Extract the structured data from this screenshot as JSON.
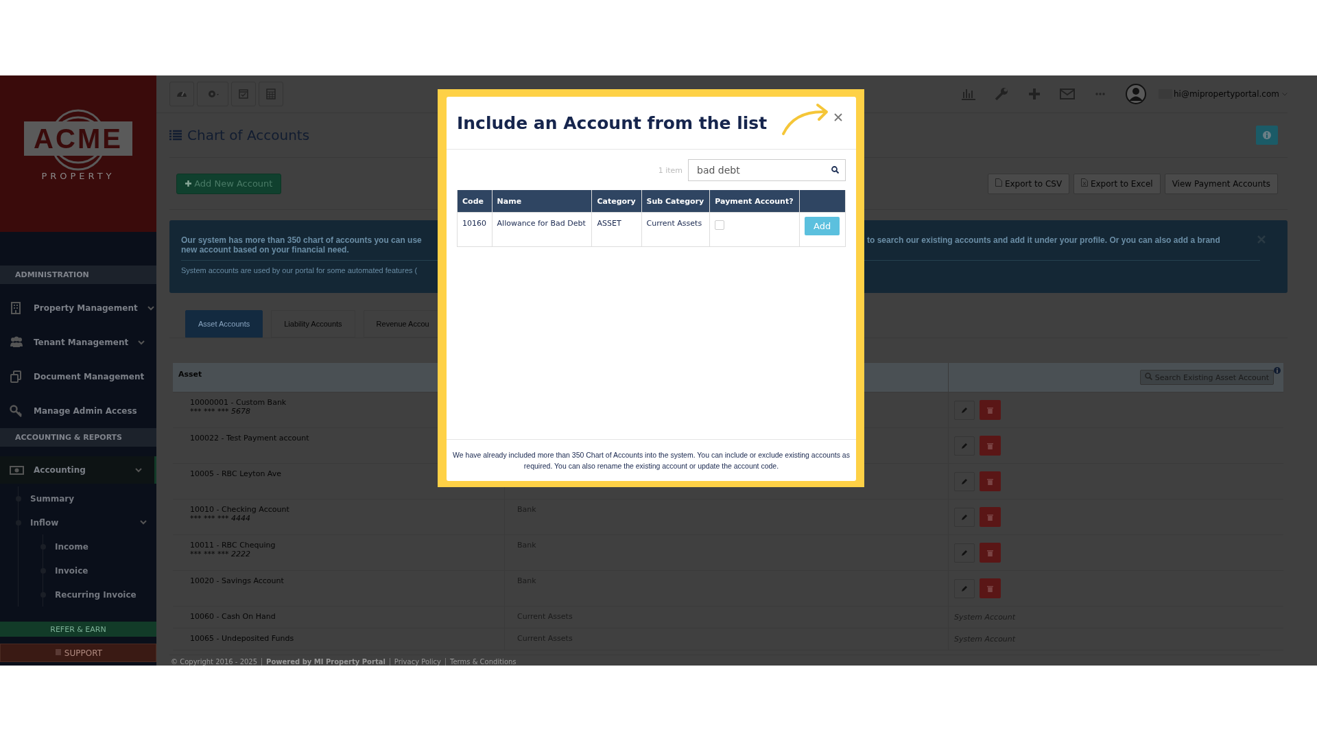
{
  "sidebar": {
    "logo": {
      "word": "ACME",
      "tagline": "PROPERTY"
    },
    "sections": [
      {
        "title": "ADMINISTRATION",
        "items": [
          {
            "label": "Property Management",
            "kind": "group",
            "selected": false
          },
          {
            "label": "Tenant Management",
            "kind": "group",
            "selected": false
          },
          {
            "label": "Document Management",
            "kind": "link",
            "selected": false
          },
          {
            "label": "Manage Admin Access",
            "kind": "link",
            "selected": false
          }
        ]
      },
      {
        "title": "ACCOUNTING & REPORTS",
        "items": [
          {
            "label": "Accounting",
            "kind": "group",
            "expanded": true,
            "selected": true,
            "children": [
              {
                "label": "Summary"
              },
              {
                "label": "Inflow",
                "kind": "group",
                "expanded": true,
                "children": [
                  {
                    "label": "Income"
                  },
                  {
                    "label": "Invoice"
                  },
                  {
                    "label": "Recurring Invoice"
                  }
                ]
              }
            ]
          }
        ]
      }
    ],
    "refer_button": "REFER & EARN",
    "support_button": "SUPPORT"
  },
  "topbar": {
    "user_email": "hi@mipropertyportal.com"
  },
  "page": {
    "title": "Chart of Accounts",
    "add_button": "Add New Account",
    "export_buttons": [
      "Export to CSV",
      "Export to Excel"
    ],
    "view_button": "View Payment Accounts",
    "banner": {
      "line_left": "Our system has more than 350 chart of accounts you can use",
      "line_right": "to search our existing accounts and add it under your profile. Or you can also add a brand",
      "line_2": "new account based on your financial need.",
      "note": "System accounts are used by our portal for some automated features ("
    },
    "tabs": [
      {
        "label": "Asset Accounts",
        "selected": true
      },
      {
        "label": "Liability Accounts",
        "selected": false
      },
      {
        "label": "Revenue Accou",
        "selected": false
      }
    ],
    "table": {
      "heading": "Asset",
      "search_button": "Search Existing Asset Account",
      "rows": [
        {
          "account": "10000001 - Custom Bank",
          "masked": "*** *** *** 5678",
          "kind": "editable"
        },
        {
          "account": "100022 - Test Payment account",
          "kind": "editable"
        },
        {
          "account": "10005 - RBC Leyton Ave",
          "kind": "editable"
        },
        {
          "account": "10010 - Checking Account",
          "masked": "*** *** *** 4444",
          "category": "Bank",
          "kind": "editable"
        },
        {
          "account": "10011 - RBC Chequing",
          "masked": "*** *** *** 2222",
          "category": "Bank",
          "kind": "editable"
        },
        {
          "account": "10020 - Savings Account",
          "category": "Bank",
          "kind": "editable"
        },
        {
          "account": "10060 - Cash On Hand",
          "category": "Current Assets",
          "kind": "system",
          "note": "System Account"
        },
        {
          "account": "10065 - Undeposited Funds",
          "category": "Current Assets",
          "kind": "system",
          "note": "System Account"
        }
      ]
    },
    "footer": {
      "copyright": "© Copyright 2016 - 2025",
      "links": [
        "Powered by MI Property Portal",
        "Privacy Policy",
        "Terms & Conditions"
      ]
    }
  },
  "modal": {
    "title": "Include an Account from the list",
    "count": "1 item",
    "search_value": "bad debt",
    "columns": [
      "Code",
      "Name",
      "Category",
      "Sub Category",
      "Payment Account?"
    ],
    "rows": [
      {
        "code": "10160",
        "name": "Allowance for Bad Debt",
        "category": "ASSET",
        "sub_category": "Current Assets",
        "payment_account": false,
        "action": "Add"
      }
    ],
    "note": "We have already included more than 350 Chart of Accounts into the system. You can include or exclude existing accounts as required. You can also rename the existing account or update the account code."
  }
}
